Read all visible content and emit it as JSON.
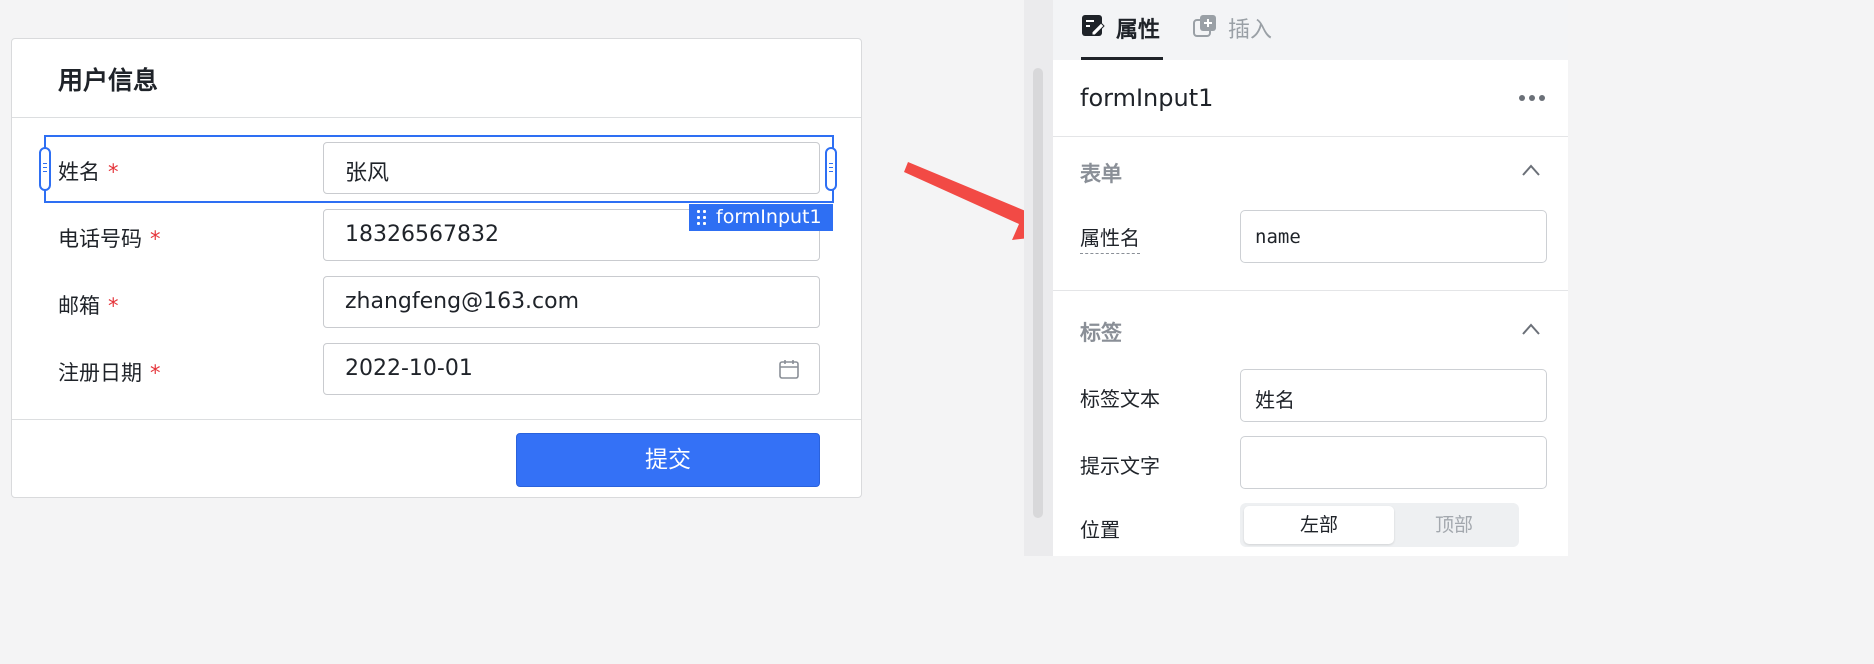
{
  "form": {
    "title": "用户信息",
    "required_mark": "*",
    "fields": [
      {
        "label": "姓名",
        "value": "张风"
      },
      {
        "label": "电话号码",
        "value": "18326567832"
      },
      {
        "label": "邮箱",
        "value": "zhangfeng@163.com"
      },
      {
        "label": "注册日期",
        "value": "2022-10-01",
        "icon": "calendar-icon"
      }
    ],
    "selected_tag": "formInput1",
    "submit_label": "提交",
    "accent_color": "#3471f6",
    "required_color": "#e5353b"
  },
  "annotation": {
    "arrow_color": "#f24a45"
  },
  "panel": {
    "tabs": [
      {
        "label": "属性",
        "icon": "edit-icon",
        "active": true
      },
      {
        "label": "插入",
        "icon": "add-copy-icon",
        "active": false
      }
    ],
    "component_name": "formInput1",
    "more_icon": "more-horizontal-icon",
    "sections": {
      "form": {
        "title": "表单",
        "attr_name_label": "属性名",
        "attr_name_value": "name"
      },
      "label": {
        "title": "标签",
        "label_text_label": "标签文本",
        "label_text_value": "姓名",
        "hint_label": "提示文字",
        "hint_value": "",
        "position_label": "位置",
        "position_options": [
          "左部",
          "顶部"
        ],
        "position_selected": "左部"
      }
    }
  }
}
